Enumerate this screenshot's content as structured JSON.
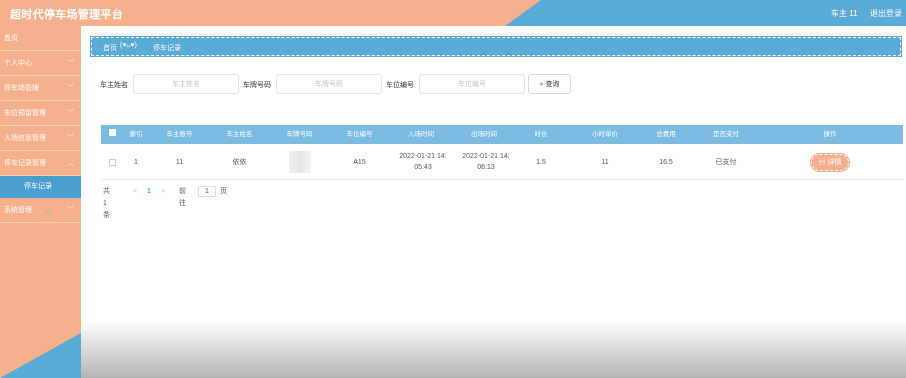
{
  "header": {
    "title": "超时代停车场管理平台",
    "user": "车主 11",
    "logout": "退出登录"
  },
  "sidebar": {
    "items": [
      {
        "label": "首页"
      },
      {
        "label": "个人中心"
      },
      {
        "label": "停车场管理"
      },
      {
        "label": "车位预留管理"
      },
      {
        "label": "入场信息管理"
      },
      {
        "label": "停车记录管理"
      },
      {
        "label": "系统管理"
      }
    ],
    "active_sub": "停车记录"
  },
  "breadcrumb": {
    "home": "首页",
    "separator": "(♥ᴗ♥)",
    "current": "停车记录"
  },
  "search": {
    "owner_label": "车主姓名",
    "owner_placeholder": "车主姓名",
    "plate_label": "车牌号码",
    "plate_placeholder": "车牌号码",
    "space_label": "车位编号",
    "space_placeholder": "车位编号",
    "button": "查询",
    "button_icon": "search-icon"
  },
  "table": {
    "columns": [
      "索引",
      "车主账号",
      "车主姓名",
      "车牌号码",
      "车位编号",
      "入场时间",
      "出场时间",
      "时长",
      "小时单价",
      "总费用",
      "是否支付",
      "操作"
    ],
    "rows": [
      {
        "index": "1",
        "account": "11",
        "name": "依依",
        "space": "A15",
        "entry": "2022-01-21 14:05:43",
        "entry_l1": "2022-01-21 14:",
        "entry_l2": "05:43",
        "exit_l1": "2022-01-21 14:",
        "exit_l2": "06:13",
        "duration": "1.5",
        "hourly": "11",
        "total": "16.5",
        "paid": "已支付",
        "action": "详情"
      }
    ]
  },
  "pager": {
    "total": "共 1 条",
    "prev": "<",
    "current": "1",
    "next": ">",
    "goto": "前往",
    "goto_value": "1",
    "page_unit": "页"
  },
  "colors": {
    "sidebar": "#f4b08d",
    "accent_blue": "#5aaad6",
    "table_header": "#7cbce2"
  }
}
